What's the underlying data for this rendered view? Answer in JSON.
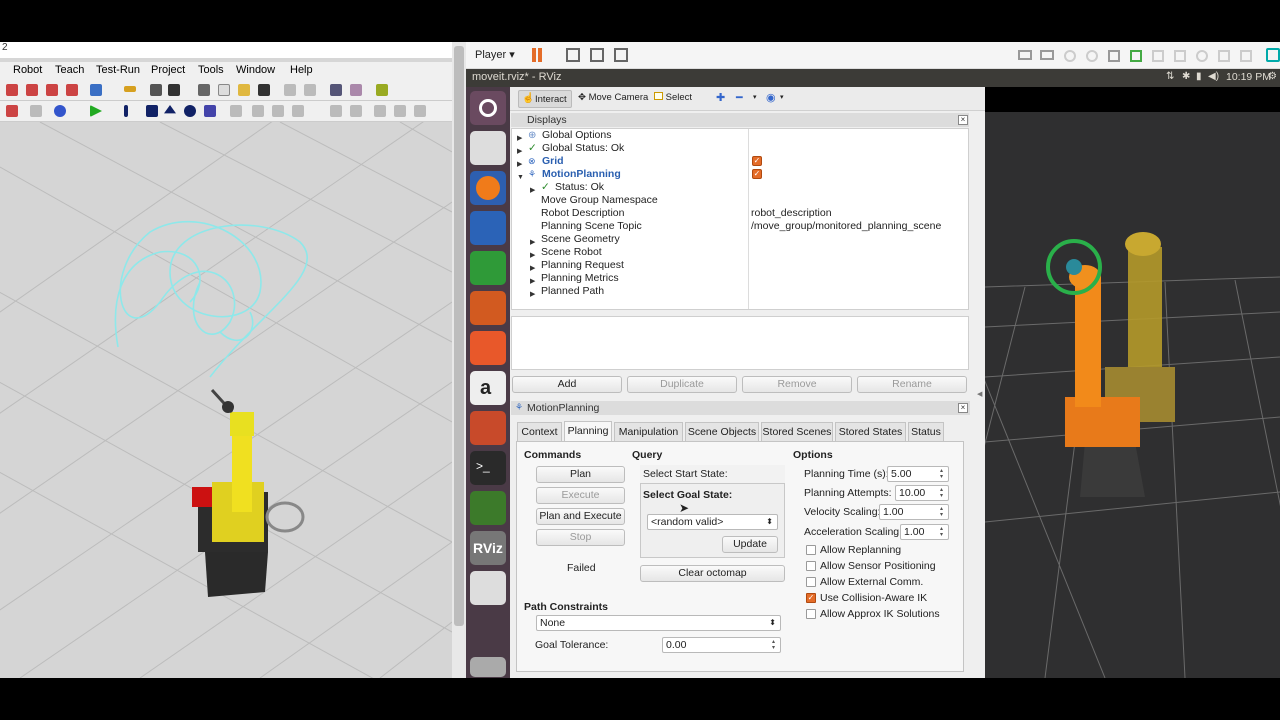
{
  "left_app": {
    "title_fragment": "2",
    "menu": [
      "Robot",
      "Teach",
      "Test-Run",
      "Project",
      "Tools",
      "Window",
      "Help"
    ]
  },
  "vm_toolbar": {
    "player_label": "Player",
    "player_arrow": "▾"
  },
  "ubuntu_bar": {
    "window_title": "moveit.rviz* - RViz",
    "time": "10:19 PM"
  },
  "rviz": {
    "toolbar": {
      "interact": "Interact",
      "move_camera": "Move Camera",
      "select": "Select"
    },
    "displays": {
      "header": "Displays",
      "rows": [
        {
          "label": "Global Options",
          "value": ""
        },
        {
          "label": "Global Status: Ok",
          "value": ""
        },
        {
          "label": "Grid",
          "value": ""
        },
        {
          "label": "MotionPlanning",
          "value": ""
        },
        {
          "label": "Status: Ok",
          "value": ""
        },
        {
          "label": "Move Group Namespace",
          "value": ""
        },
        {
          "label": "Robot Description",
          "value": "robot_description"
        },
        {
          "label": "Planning Scene Topic",
          "value": "/move_group/monitored_planning_scene"
        },
        {
          "label": "Scene Geometry",
          "value": ""
        },
        {
          "label": "Scene Robot",
          "value": ""
        },
        {
          "label": "Planning Request",
          "value": ""
        },
        {
          "label": "Planning Metrics",
          "value": ""
        },
        {
          "label": "Planned Path",
          "value": ""
        }
      ],
      "buttons": {
        "add": "Add",
        "duplicate": "Duplicate",
        "remove": "Remove",
        "rename": "Rename"
      }
    },
    "motion_planning": {
      "header": "MotionPlanning",
      "tabs": [
        "Context",
        "Planning",
        "Manipulation",
        "Scene Objects",
        "Stored Scenes",
        "Stored States",
        "Status"
      ],
      "active_tab": "Planning",
      "commands": {
        "title": "Commands",
        "plan": "Plan",
        "execute": "Execute",
        "plan_and_execute": "Plan and Execute",
        "stop": "Stop",
        "status": "Failed"
      },
      "query": {
        "title": "Query",
        "start_state": "Select Start State:",
        "goal_state": "Select Goal State:",
        "goal_value": "<random valid>",
        "update": "Update",
        "clear_octomap": "Clear octomap"
      },
      "options": {
        "title": "Options",
        "planning_time_label": "Planning Time (s):",
        "planning_time": "5.00",
        "planning_attempts_label": "Planning Attempts:",
        "planning_attempts": "10.00",
        "velocity_label": "Velocity Scaling:",
        "velocity": "1.00",
        "accel_label": "Acceleration Scaling:",
        "accel": "1.00",
        "checks": [
          {
            "label": "Allow Replanning",
            "checked": false
          },
          {
            "label": "Allow Sensor Positioning",
            "checked": false
          },
          {
            "label": "Allow External Comm.",
            "checked": false
          },
          {
            "label": "Use Collision-Aware IK",
            "checked": true
          },
          {
            "label": "Allow Approx IK Solutions",
            "checked": false
          }
        ]
      },
      "path_constraints": {
        "title": "Path Constraints",
        "value": "None",
        "goal_tolerance_label": "Goal Tolerance:",
        "goal_tolerance": "0.00"
      }
    }
  },
  "colors": {
    "accent_orange": "#e46c28",
    "launcher": "#4a3a46",
    "ubuntu_bar": "#3c3b37",
    "viewport_bg": "#2f2f30"
  }
}
